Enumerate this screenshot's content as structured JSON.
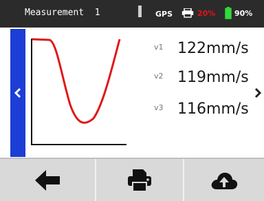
{
  "status_bar": {
    "title": "Measurement  1",
    "gps_label": "GPS",
    "printer_percent": "20%",
    "battery_percent": "90%",
    "icons": [
      "signal-bar",
      "printer-icon",
      "battery-icon"
    ],
    "colors": {
      "background": "#2b2b2b",
      "printer_warning": "#e01515",
      "battery": "#2fdc3a"
    }
  },
  "readings": [
    {
      "label": "v1",
      "value": "122mm/s"
    },
    {
      "label": "v2",
      "value": "119mm/s"
    },
    {
      "label": "v3",
      "value": "116mm/s"
    }
  ],
  "navigation": {
    "left_icon": "chevron-left-icon",
    "right_icon": "chevron-right-icon",
    "accent": "#1c3dd6"
  },
  "chart": {
    "type": "line",
    "curve_color": "#e01818",
    "axes_visible": true
  },
  "toolbar": {
    "buttons": [
      "back-arrow-icon",
      "printer-icon",
      "cloud-upload-icon"
    ]
  }
}
